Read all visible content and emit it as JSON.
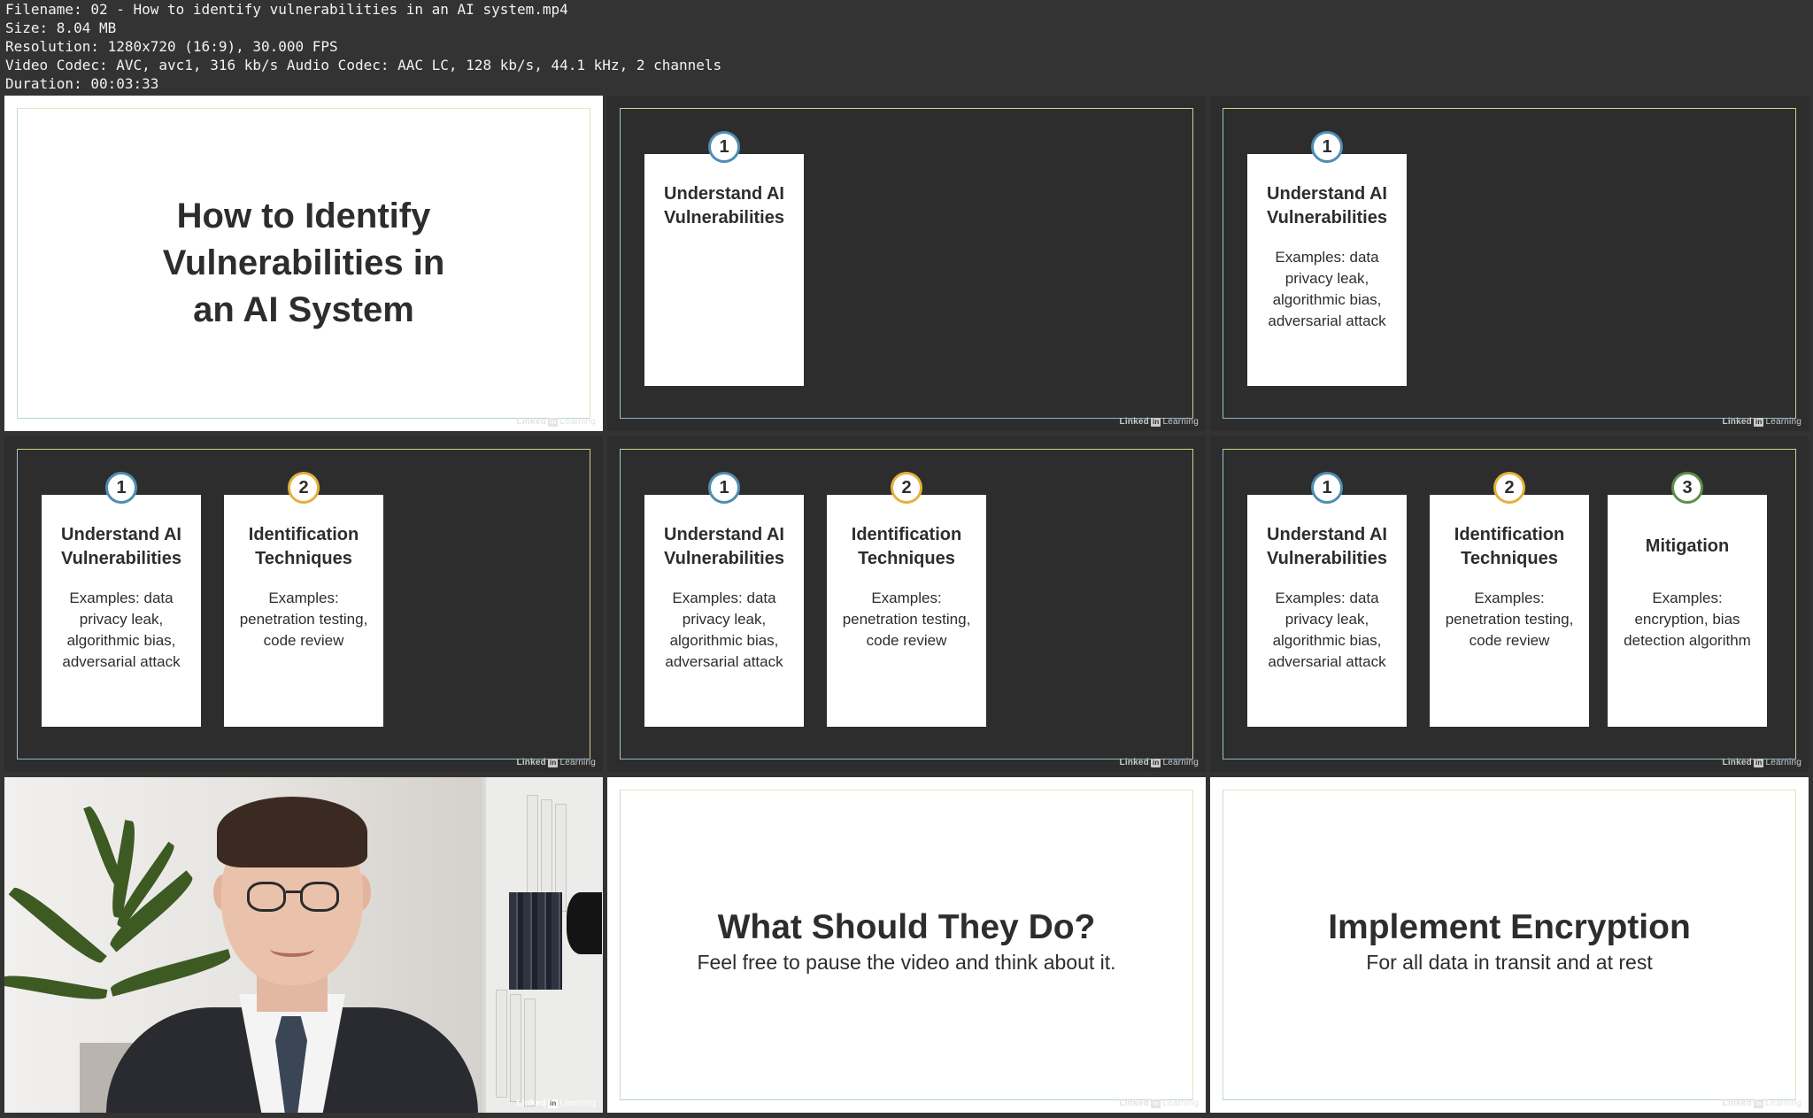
{
  "meta": {
    "filename": "Filename: 02 - How to identify vulnerabilities in an AI system.mp4",
    "size": "Size: 8.04 MB",
    "resolution": "Resolution: 1280x720 (16:9), 30.000 FPS",
    "codec": "Video Codec: AVC, avc1, 316 kb/s Audio Codec: AAC LC, 128 kb/s, 44.1 kHz, 2 channels",
    "duration": "Duration: 00:03:33"
  },
  "logo": {
    "linked": "Linked",
    "in": "in",
    "learning": "Learning"
  },
  "title_slide": {
    "line1": "How to Identify",
    "line2": "Vulnerabilities in",
    "line3": "an AI System"
  },
  "cards": {
    "c1": {
      "num": "1",
      "title_l1": "Understand AI",
      "title_l2": "Vulnerabilities",
      "desc_l1": "Examples: data",
      "desc_l2": "privacy leak,",
      "desc_l3": "algorithmic bias,",
      "desc_l4": "adversarial attack"
    },
    "c2": {
      "num": "2",
      "title_l1": "Identification",
      "title_l2": "Techniques",
      "desc_l1": "Examples:",
      "desc_l2": "penetration testing,",
      "desc_l3": "code review"
    },
    "c3": {
      "num": "3",
      "title_l1": "Mitigation",
      "desc_l1": "Examples:",
      "desc_l2": "encryption, bias",
      "desc_l3": "detection algorithm"
    }
  },
  "slide_what": {
    "title": "What Should They Do?",
    "subtitle": "Feel free to pause the video and think about it."
  },
  "slide_encrypt": {
    "title": "Implement Encryption",
    "subtitle": "For all data in transit and at rest"
  },
  "colors": {
    "num1_border": "#4f8db3",
    "num2_border": "#e3b23c",
    "num3_border": "#5f8e4a",
    "dark_slide_bg": "#2d2d2d"
  }
}
